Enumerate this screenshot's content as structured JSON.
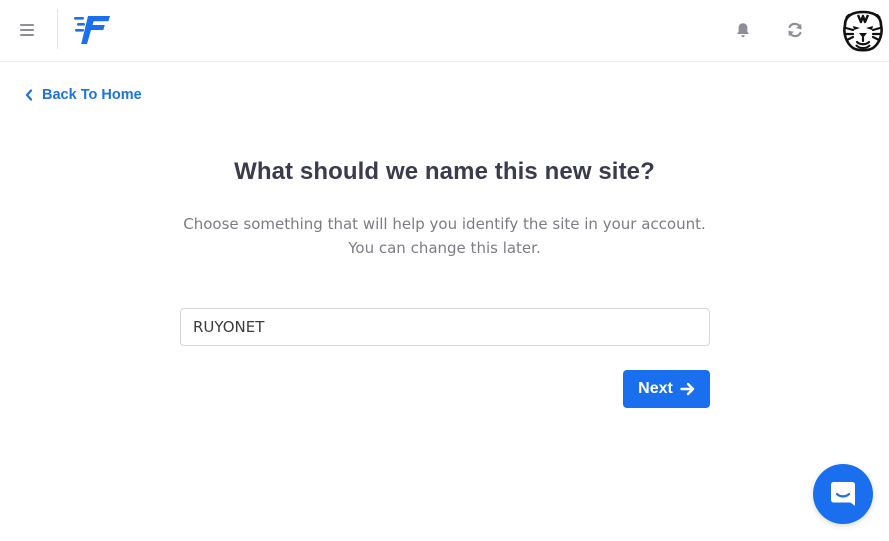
{
  "header": {
    "menu_icon": "hamburger-icon",
    "logo_icon": "brand-logo-icon",
    "notifications_icon": "bell-icon",
    "refresh_icon": "refresh-icon",
    "avatar_icon": "tiger-avatar-icon"
  },
  "nav": {
    "back_label": "Back To Home",
    "back_icon": "chevron-left-icon"
  },
  "form": {
    "title": "What should we name this new site?",
    "subtitle_line1": "Choose something that will help you identify the site in your account.",
    "subtitle_line2": "You can change this later.",
    "site_name_value": "RUYONET",
    "next_label": "Next",
    "next_icon": "arrow-right-icon"
  },
  "chat": {
    "icon": "chat-bubble-icon"
  },
  "colors": {
    "accent": "#1a6fef",
    "link": "#1a73e8",
    "title": "#3a3b4e",
    "subtitle": "#7c7c86",
    "icon_gray": "#8e8e98"
  }
}
